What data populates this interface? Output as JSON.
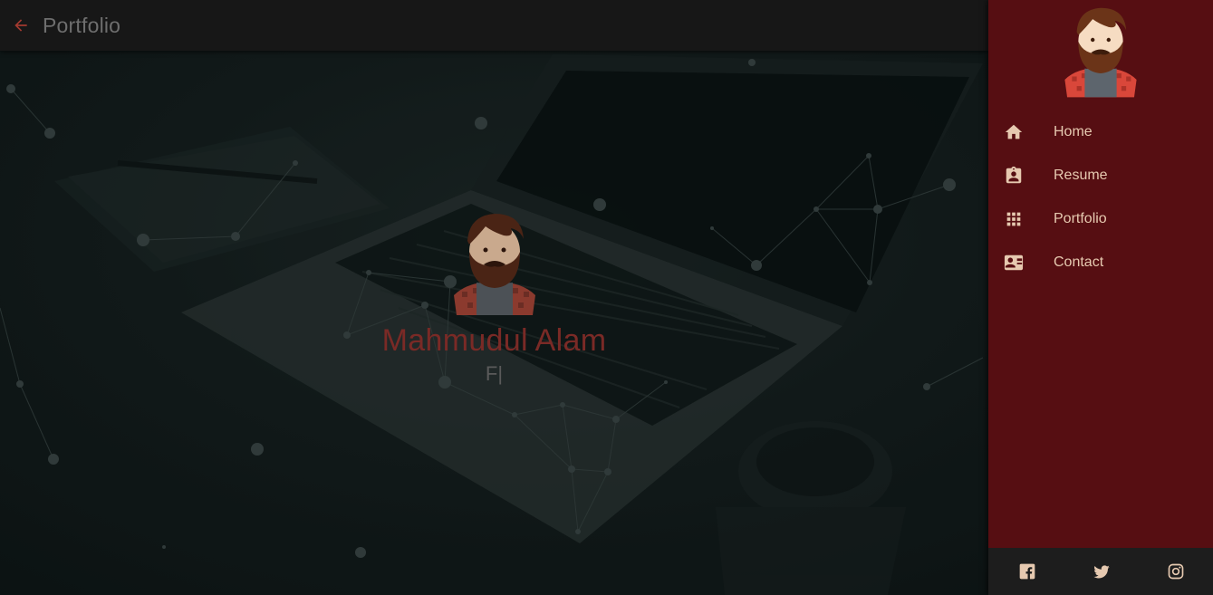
{
  "appbar": {
    "title": "Portfolio",
    "back_icon": "arrow-left-icon",
    "back_color": "#a33a30"
  },
  "hero": {
    "name": "Mahmudul Alam",
    "typed_text": "F|",
    "avatar_icon": "bearded-man-avatar"
  },
  "drawer": {
    "background": "#560e12",
    "accent_text": "#e6c9b0",
    "avatar_icon": "bearded-man-avatar",
    "items": [
      {
        "label": "Home",
        "icon": "home-icon"
      },
      {
        "label": "Resume",
        "icon": "clipboard-account-icon"
      },
      {
        "label": "Portfolio",
        "icon": "apps-grid-icon"
      },
      {
        "label": "Contact",
        "icon": "contact-card-icon"
      }
    ],
    "social": [
      {
        "icon": "facebook-icon"
      },
      {
        "icon": "twitter-icon"
      },
      {
        "icon": "instagram-icon"
      }
    ]
  }
}
